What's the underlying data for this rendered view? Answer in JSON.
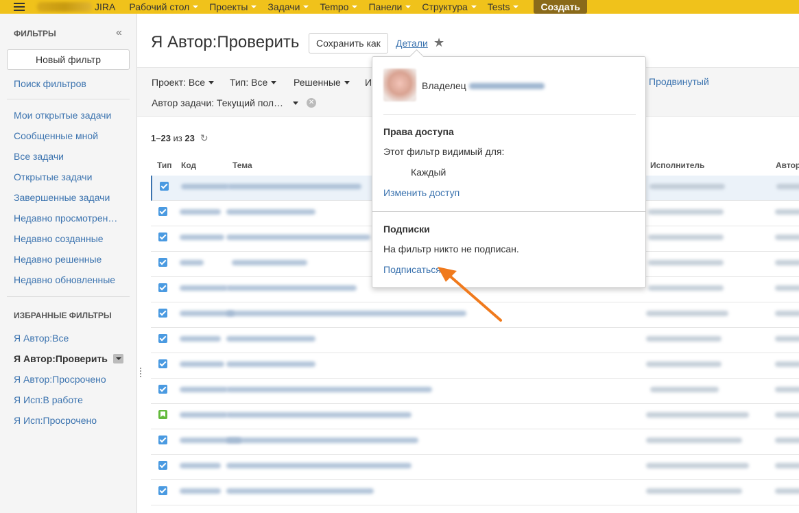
{
  "topbar": {
    "logo_text": "JIRA",
    "nav": [
      "Рабочий стол",
      "Проекты",
      "Задачи",
      "Tempo",
      "Панели",
      "Структура",
      "Tests"
    ],
    "create_label": "Создать",
    "accent_color": "#f0c21b"
  },
  "sidebar": {
    "header": "ФИЛЬТРЫ",
    "collapse_icon": "double-chevron-left-icon",
    "new_filter": "Новый фильтр",
    "search_filters": "Поиск фильтров",
    "system_filters": [
      "Мои открытые задачи",
      "Сообщенные мной",
      "Все задачи",
      "Открытые задачи",
      "Завершенные задачи",
      "Недавно просмотрен…",
      "Недавно созданные",
      "Недавно решенные",
      "Недавно обновленные"
    ],
    "favorites_header": "ИЗБРАННЫЕ ФИЛЬТРЫ",
    "favorites": [
      "Я Автор:Все",
      "Я Автор:Проверить",
      "Я Автор:Просрочено",
      "Я Исп:В работе",
      "Я Исп:Просрочено"
    ],
    "active_favorite": "Я Автор:Проверить"
  },
  "main": {
    "title": "Я Автор:Проверить",
    "save_as": "Сохранить как",
    "details": "Детали",
    "filters": {
      "project": "Проект: Все",
      "type": "Тип: Все",
      "resolved": "Решенные",
      "partial": "И",
      "author": "Автор задачи: Текущий пол…",
      "advanced": "Продвинутый"
    },
    "count_range": "1–23",
    "count_of": "из",
    "count_total": "23",
    "columns": {
      "type": "Тип",
      "key": "Код",
      "summary": "Тема",
      "assignee": "Исполнитель",
      "reporter": "Автор"
    },
    "row_types": [
      "task",
      "task",
      "task",
      "task",
      "task",
      "task",
      "task",
      "task",
      "task",
      "story",
      "task",
      "task",
      "task"
    ]
  },
  "popup": {
    "owner_label": "Владелец",
    "access_header": "Права доступа",
    "visible_for": "Этот фильтр видимый для:",
    "everyone": "Каждый",
    "change_access": "Изменить доступ",
    "subs_header": "Подписки",
    "no_subs": "На фильтр никто не подписан.",
    "subscribe": "Подписаться"
  }
}
